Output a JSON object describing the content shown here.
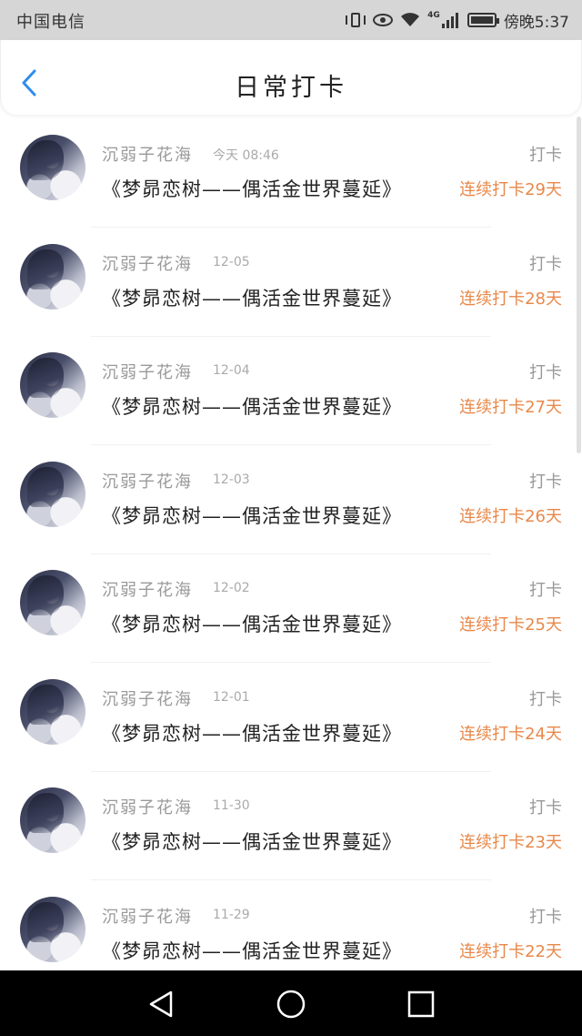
{
  "status_bar": {
    "carrier": "中国电信",
    "network": "4G",
    "time": "傍晚5:37"
  },
  "header": {
    "title": "日常打卡"
  },
  "colors": {
    "accent_blue": "#2f8cf0",
    "streak_orange": "#e8884a",
    "status_bar_bg": "#d6d6d6",
    "nav_bar_bg": "#000000"
  },
  "entries": [
    {
      "name": "沉弱子花海",
      "time": "今天 08:46",
      "book": "《梦昴恋树——偶活金世界蔓延》",
      "action": "打卡",
      "streak": "连续打卡29天"
    },
    {
      "name": "沉弱子花海",
      "time": "12-05",
      "book": "《梦昴恋树——偶活金世界蔓延》",
      "action": "打卡",
      "streak": "连续打卡28天"
    },
    {
      "name": "沉弱子花海",
      "time": "12-04",
      "book": "《梦昴恋树——偶活金世界蔓延》",
      "action": "打卡",
      "streak": "连续打卡27天"
    },
    {
      "name": "沉弱子花海",
      "time": "12-03",
      "book": "《梦昴恋树——偶活金世界蔓延》",
      "action": "打卡",
      "streak": "连续打卡26天"
    },
    {
      "name": "沉弱子花海",
      "time": "12-02",
      "book": "《梦昴恋树——偶活金世界蔓延》",
      "action": "打卡",
      "streak": "连续打卡25天"
    },
    {
      "name": "沉弱子花海",
      "time": "12-01",
      "book": "《梦昴恋树——偶活金世界蔓延》",
      "action": "打卡",
      "streak": "连续打卡24天"
    },
    {
      "name": "沉弱子花海",
      "time": "11-30",
      "book": "《梦昴恋树——偶活金世界蔓延》",
      "action": "打卡",
      "streak": "连续打卡23天"
    },
    {
      "name": "沉弱子花海",
      "time": "11-29",
      "book": "《梦昴恋树——偶活金世界蔓延》",
      "action": "打卡",
      "streak": "连续打卡22天"
    }
  ],
  "icons": {
    "back": "chevron-left-icon",
    "nav_back": "triangle-back-icon",
    "nav_home": "circle-home-icon",
    "nav_recent": "square-recent-icon"
  }
}
